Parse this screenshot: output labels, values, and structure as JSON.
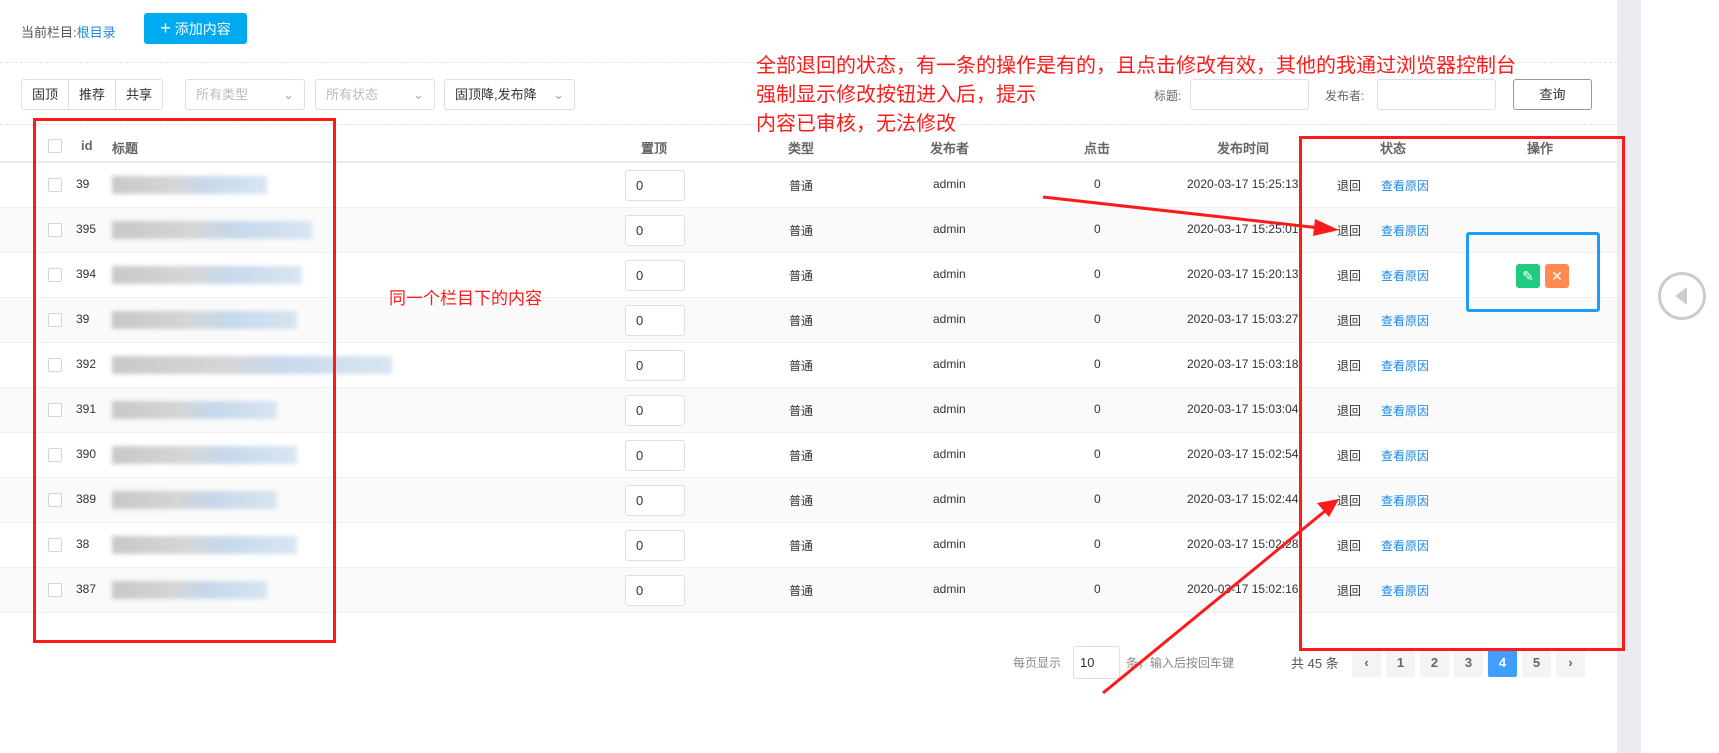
{
  "breadcrumb": {
    "label": "当前栏目:",
    "current": "根目录"
  },
  "add_button": {
    "icon": "plus-icon",
    "label": "添加内容"
  },
  "filters": {
    "toggles": [
      "固顶",
      "推荐",
      "共享"
    ],
    "type_select": "所有类型",
    "status_select": "所有状态",
    "sort_select": "固顶降,发布降"
  },
  "search": {
    "title_label": "标题:",
    "title_value": "",
    "publisher_label": "发布者:",
    "publisher_value": "",
    "query_button": "查询"
  },
  "table": {
    "headers": {
      "id": "id",
      "title": "标题",
      "top": "置顶",
      "type": "类型",
      "publisher": "发布者",
      "clicks": "点击",
      "time": "发布时间",
      "status": "状态",
      "action": "操作"
    },
    "rows": [
      {
        "id": "39",
        "top": "0",
        "type": "普通",
        "publisher": "admin",
        "clicks": "0",
        "time": "2020-03-17 15:25:13",
        "status": "退回",
        "reason": "查看原因"
      },
      {
        "id": "395",
        "top": "0",
        "type": "普通",
        "publisher": "admin",
        "clicks": "0",
        "time": "2020-03-17 15:25:01",
        "status": "退回",
        "reason": "查看原因"
      },
      {
        "id": "394",
        "top": "0",
        "type": "普通",
        "publisher": "admin",
        "clicks": "0",
        "time": "2020-03-17 15:20:13",
        "status": "退回",
        "reason": "查看原因"
      },
      {
        "id": "39",
        "top": "0",
        "type": "普通",
        "publisher": "admin",
        "clicks": "0",
        "time": "2020-03-17 15:03:27",
        "status": "退回",
        "reason": "查看原因"
      },
      {
        "id": "392",
        "top": "0",
        "type": "普通",
        "publisher": "admin",
        "clicks": "0",
        "time": "2020-03-17 15:03:18",
        "status": "退回",
        "reason": "查看原因"
      },
      {
        "id": "391",
        "top": "0",
        "type": "普通",
        "publisher": "admin",
        "clicks": "0",
        "time": "2020-03-17 15:03:04",
        "status": "退回",
        "reason": "查看原因"
      },
      {
        "id": "390",
        "top": "0",
        "type": "普通",
        "publisher": "admin",
        "clicks": "0",
        "time": "2020-03-17 15:02:54",
        "status": "退回",
        "reason": "查看原因"
      },
      {
        "id": "389",
        "top": "0",
        "type": "普通",
        "publisher": "admin",
        "clicks": "0",
        "time": "2020-03-17 15:02:44",
        "status": "退回",
        "reason": "查看原因"
      },
      {
        "id": "38",
        "top": "0",
        "type": "普通",
        "publisher": "admin",
        "clicks": "0",
        "time": "2020-03-17 15:02:28",
        "status": "退回",
        "reason": "查看原因"
      },
      {
        "id": "387",
        "top": "0",
        "type": "普通",
        "publisher": "admin",
        "clicks": "0",
        "time": "2020-03-17 15:02:16",
        "status": "退回",
        "reason": "查看原因"
      }
    ]
  },
  "pagination": {
    "per_page_label": "每页显示",
    "per_page_value": "10",
    "per_page_hint": "条，输入后按回车键",
    "total": "共 45 条",
    "pages": [
      "1",
      "2",
      "3",
      "4",
      "5"
    ],
    "current": "4"
  },
  "annotations": {
    "note_lines": [
      "全部退回的状态，有一条的操作是有的，且点击修改有效，其他的我通过浏览器控制台",
      "强制显示修改按钮进入后，提示",
      "内容已审核，无法修改"
    ],
    "left_note": "同一个栏目下的内容"
  },
  "colors": {
    "primary": "#00aaf0",
    "link": "#1e88e5",
    "active_page": "#409eff",
    "edit": "#1fcb7e",
    "delete": "#ff8a50",
    "annotation": "#ff1a1a",
    "highlight": "#1e9bff"
  }
}
